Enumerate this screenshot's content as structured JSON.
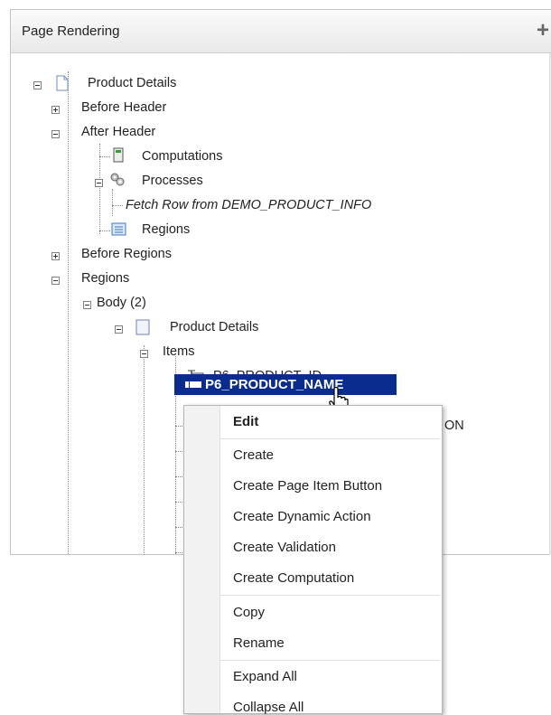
{
  "panel": {
    "title": "Page Rendering",
    "add_icon": "+"
  },
  "tree": {
    "root": "Product Details",
    "before_header": "Before Header",
    "after_header": "After Header",
    "computations": "Computations",
    "processes": "Processes",
    "fetch_row": "Fetch Row from DEMO_PRODUCT_INFO",
    "regions_sub": "Regions",
    "before_regions": "Before Regions",
    "regions": "Regions",
    "body": "Body (2)",
    "product_details": "Product Details",
    "items": "Items",
    "item_id": "P6_PRODUCT_ID",
    "item_name": "P6_PRODUCT_NAME",
    "item_partial": "ON"
  },
  "context_menu": {
    "items": [
      "Edit",
      "Create",
      "Create Page Item Button",
      "Create Dynamic Action",
      "Create Validation",
      "Create Computation",
      "Copy",
      "Rename",
      "Expand All",
      "Collapse All"
    ]
  },
  "icons": {
    "page": "page-icon",
    "computation": "calculator-icon",
    "process": "gears-icon",
    "region": "region-icon",
    "item": "text-item-icon",
    "cursor": "hand-cursor-icon"
  },
  "colors": {
    "selection": "#0a2c8f",
    "accent_blue": "#3b78c8",
    "computation_green": "#3a9a3a"
  }
}
